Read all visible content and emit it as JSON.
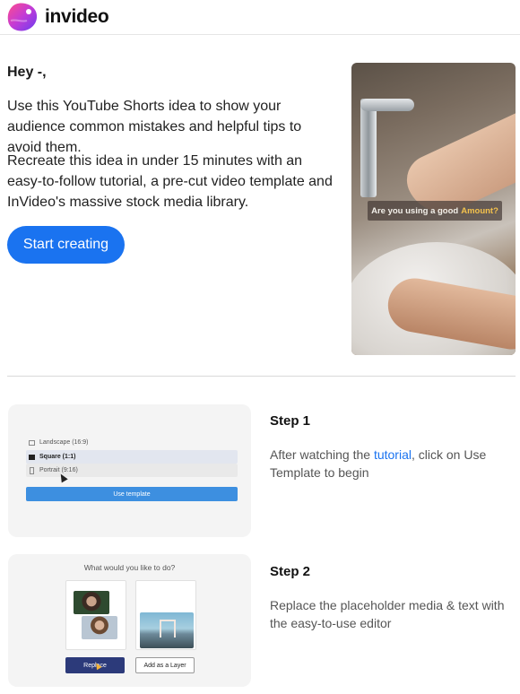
{
  "brand": {
    "name": "invideo"
  },
  "intro": {
    "greeting": "Hey -,",
    "paragraph1": "Use this YouTube Shorts idea to show your audience common mistakes and helpful tips to avoid them.",
    "paragraph2": "Recreate this idea in under 15 minutes with an easy-to-follow tutorial, a pre-cut video template and InVideo's massive stock media library.",
    "cta_label": "Start creating"
  },
  "hero": {
    "caption_prefix": "Are you using a good",
    "caption_highlight": "Amount?"
  },
  "step1": {
    "heading": "Step 1",
    "text_before": "After watching the ",
    "link_text": "tutorial",
    "text_after": ", click on Use Template to begin",
    "mock": {
      "options": [
        "Landscape (16:9)",
        "Square (1:1)",
        "Portrait (9:16)"
      ],
      "selected": "Square (1:1)",
      "button_label": "Use template"
    }
  },
  "step2": {
    "heading": "Step 2",
    "text": "Replace the placeholder media & text with the easy-to-use editor",
    "mock": {
      "title": "What would you like to do?",
      "replace_label": "Replace",
      "layer_label": "Add as a Layer"
    }
  },
  "colors": {
    "accent": "#1a73f0",
    "replace_button": "#2c3a7a",
    "highlight": "#f4c24d"
  }
}
